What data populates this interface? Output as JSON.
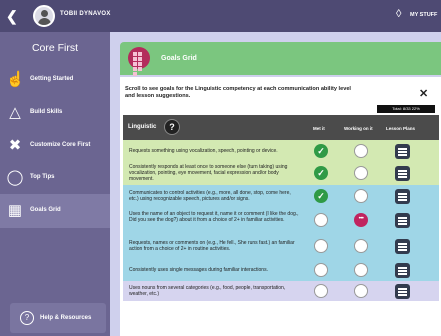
{
  "topbar": {
    "back_icon": "chevron-left-icon",
    "user_name": "TOBII DYNAVOX",
    "stuff_label": "MY STUFF",
    "stuff_icon": "layers-icon"
  },
  "sidebar": {
    "title": "Core First",
    "items": [
      {
        "label": "Getting Started",
        "icon": "hand-pointer-icon"
      },
      {
        "label": "Build Skills",
        "icon": "graduation-cap-icon"
      },
      {
        "label": "Customize Core First",
        "icon": "tools-icon"
      },
      {
        "label": "Top Tips",
        "icon": "lightbulb-icon"
      },
      {
        "label": "Goals Grid",
        "icon": "grid-icon"
      }
    ],
    "help_label": "Help & Resources"
  },
  "main": {
    "header_title": "Goals Grid",
    "intro": "Scroll to see goals for the Linguistic competency at each communication ability level and lesson suggestions.",
    "total": "Total: 8/33 22%",
    "category": "Linguistic",
    "columns": {
      "met": "Met it",
      "working": "Working on it",
      "lesson": "Lesson Plans"
    },
    "colors": {
      "green_row": "#d3e9b2",
      "cyan_row": "#9fd6e7",
      "purple_row": "#d6d4ef",
      "met": "#2f9a46",
      "working": "#c0245f"
    },
    "rows": [
      {
        "text": "Requests something using vocalization, speech, pointing or device.",
        "met": true,
        "working": false,
        "color": "#d3e9b2"
      },
      {
        "text": "Consistently responds at least once to someone else (turn taking) using vocalization, pointing, eye movement, facial expression and/or body movement.",
        "met": true,
        "working": false,
        "color": "#d3e9b2"
      },
      {
        "text": "Communicates to control activities (e.g., more, all done, stop, come here, etc.) using recognizable speech, pictures and/or signs.",
        "met": true,
        "working": false,
        "color": "#9fd6e7"
      },
      {
        "text": "Uses the name of an object to request it, name it or comment (I like the dog., Did you see the dog?) about it from a choice of 2+ in familiar activities.",
        "met": false,
        "working": true,
        "color": "#9fd6e7"
      },
      {
        "text": "Requests, names or comments on (e.g., He fell., She runs fast.) an familiar action from a choice of 2+ in routine activities.",
        "met": false,
        "working": false,
        "color": "#9fd6e7"
      },
      {
        "text": "Consistently uses single messages during familiar interactions.",
        "met": false,
        "working": false,
        "color": "#9fd6e7"
      },
      {
        "text": "Uses nouns from several categories (e.g., food, people, transportation, weather, etc.)",
        "met": false,
        "working": false,
        "color": "#d6d4ef"
      }
    ]
  }
}
